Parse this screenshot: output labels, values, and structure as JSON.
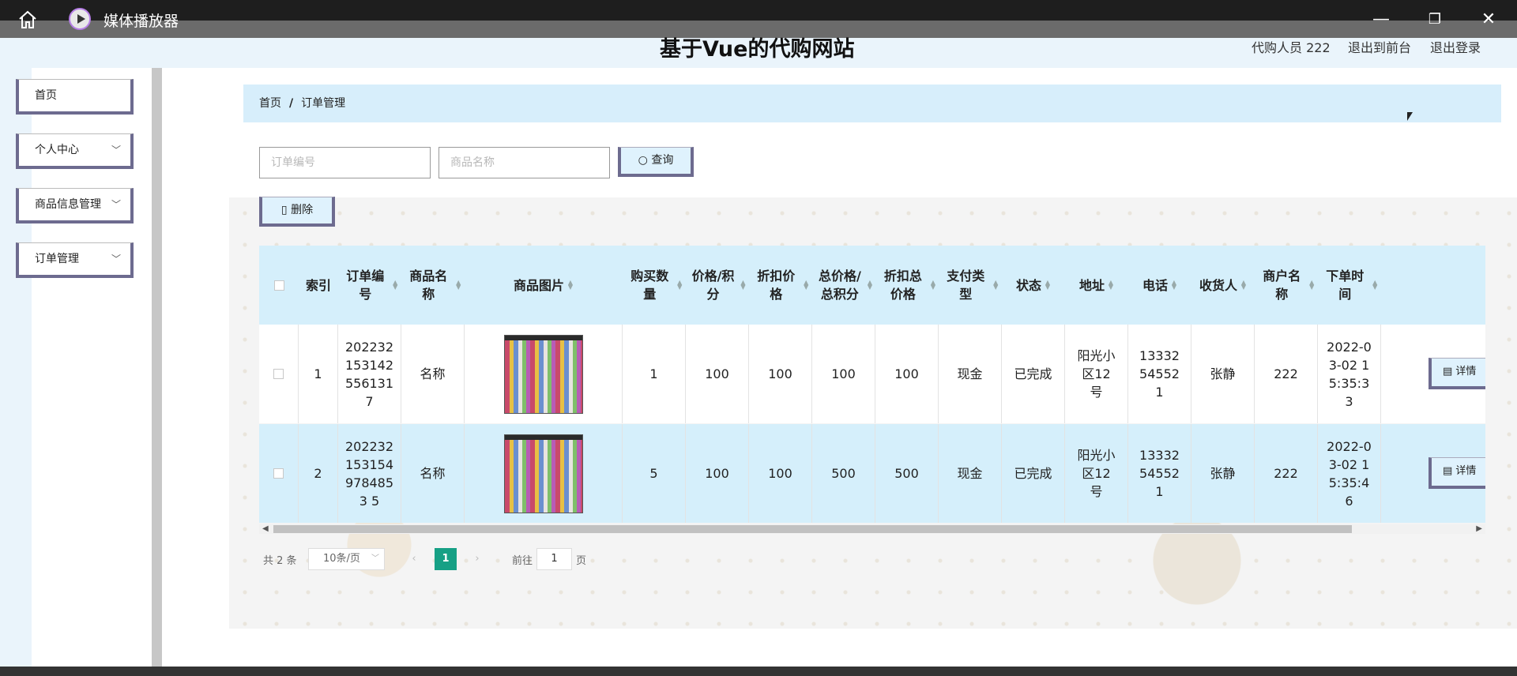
{
  "window": {
    "title": "媒体播放器",
    "minimize_icon": "—",
    "maximize_icon": "❐",
    "close_icon": "✕"
  },
  "header": {
    "title": "基于Vue的代购网站",
    "user": "代购人员 222",
    "to_front": "退出到前台",
    "logout": "退出登录"
  },
  "sidebar": {
    "items": [
      {
        "label": "首页",
        "chevron": ""
      },
      {
        "label": "个人中心",
        "chevron": "﹀"
      },
      {
        "label": "商品信息管理",
        "chevron": "﹀"
      },
      {
        "label": "订单管理",
        "chevron": "﹀"
      }
    ]
  },
  "breadcrumb": {
    "home": "首页",
    "separator": "/",
    "current": "订单管理"
  },
  "search": {
    "order_placeholder": "订单编号",
    "product_placeholder": "商品名称",
    "query_label": "查询",
    "delete_label": "删除"
  },
  "table": {
    "headers": [
      "索引",
      "订单编号",
      "商品名称",
      "商品图片",
      "购买数量",
      "价格/积分",
      "折扣价格",
      "总价格/总积分",
      "折扣总价格",
      "支付类型",
      "状态",
      "地址",
      "电话",
      "收货人",
      "商户名称",
      "下单时间"
    ],
    "rows": [
      {
        "index": "1",
        "order_no": "2022321531425561317",
        "name": "名称",
        "qty": "1",
        "price": "100",
        "discount": "100",
        "total": "100",
        "discount_total": "100",
        "pay": "现金",
        "status": "已完成",
        "address": "阳光小区12号",
        "phone": "13332545521",
        "receiver": "张静",
        "merchant": "222",
        "time": "2022-03-02 15:35:33",
        "detail": "详情"
      },
      {
        "index": "2",
        "order_no": "2022321531549784853 5",
        "name": "名称",
        "qty": "5",
        "price": "100",
        "discount": "100",
        "total": "500",
        "discount_total": "500",
        "pay": "现金",
        "status": "已完成",
        "address": "阳光小区12号",
        "phone": "13332545521",
        "receiver": "张静",
        "merchant": "222",
        "time": "2022-03-02 15:35:46",
        "detail": "详情"
      }
    ]
  },
  "pagination": {
    "total": "共 2 条",
    "page_size": "10条/页",
    "current_page": "1",
    "goto_prefix": "前往",
    "goto_value": "1",
    "goto_suffix": "页"
  },
  "colors": {
    "accent": "#16a085",
    "header_bg": "#d5effb",
    "button_border": "#6d6b8f"
  }
}
